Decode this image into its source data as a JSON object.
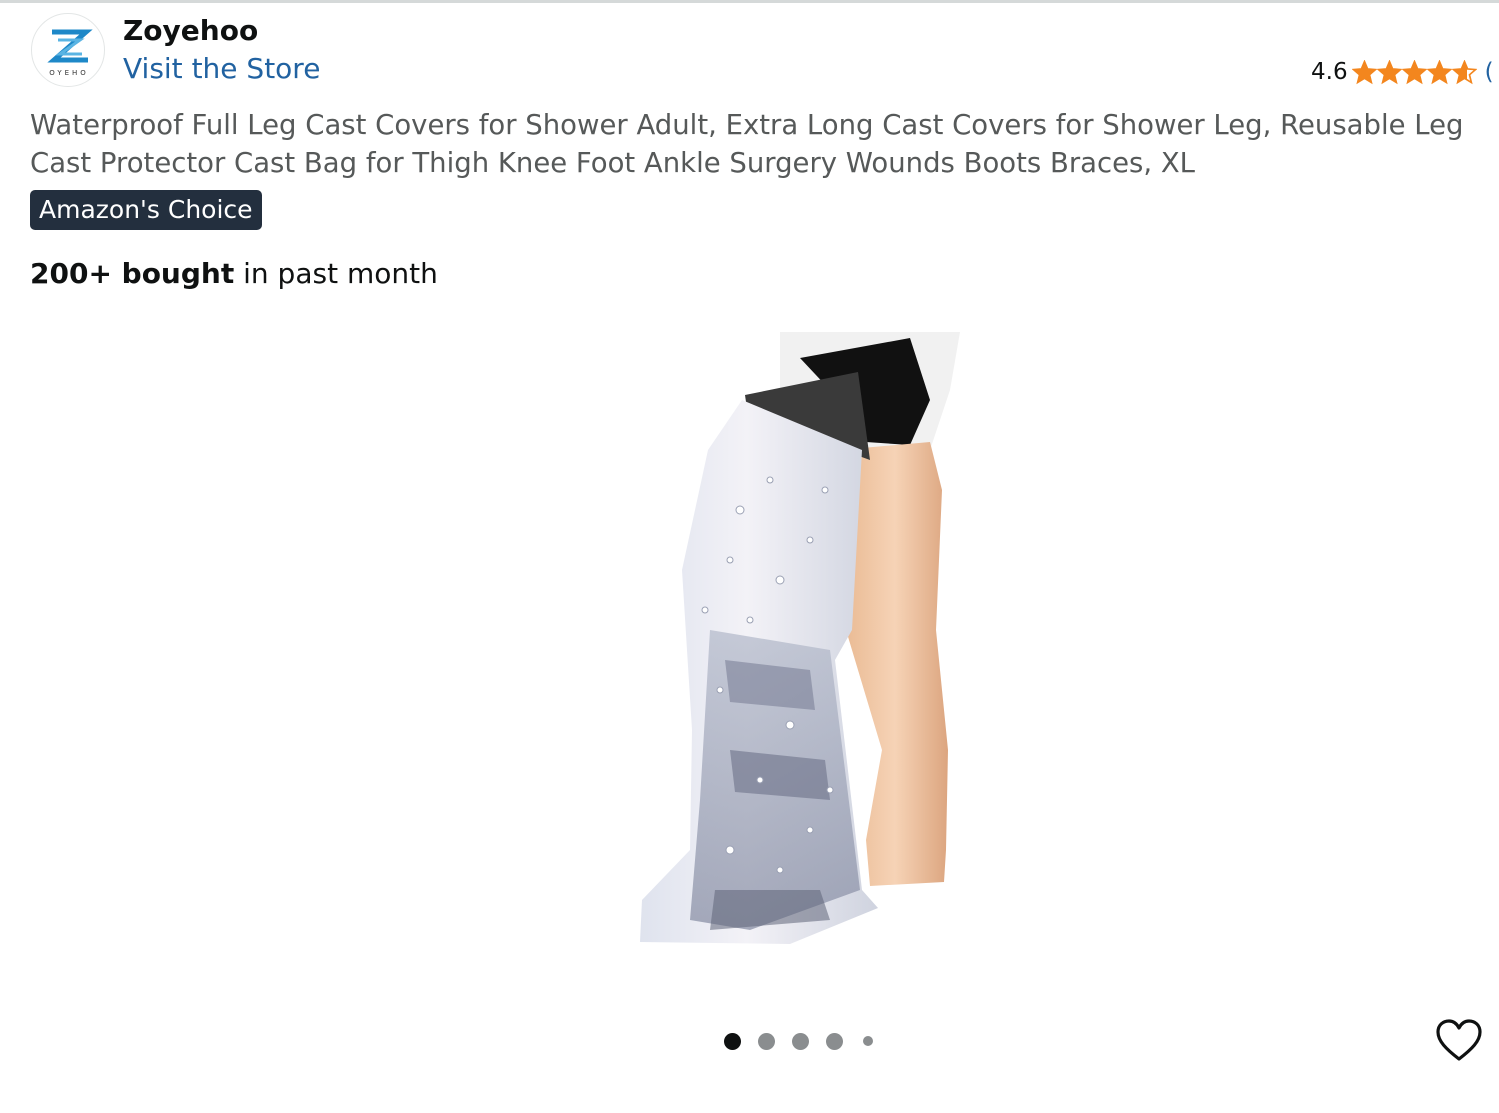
{
  "header": {
    "brand_name": "Zoyehoo",
    "visit_store_label": "Visit the Store",
    "logo_text": "OYEHO"
  },
  "rating": {
    "value": "4.6",
    "stars": 4.6,
    "count_prefix": "(",
    "star_color": "#f3861e"
  },
  "product": {
    "title": "Waterproof Full Leg Cast Covers for Shower Adult, Extra Long Cast Covers for Shower Leg, Reusable Leg Cast Protector Cast Bag for Thigh Knee Foot Ankle Surgery Wounds Boots Braces, XL",
    "badge": "Amazon's Choice",
    "bought_bold": "200+ bought",
    "bought_rest": " in past month"
  },
  "carousel": {
    "total_images": 5,
    "active_index": 0
  },
  "icons": {
    "logo": "zoyehoo-logo-icon",
    "star": "star-icon",
    "wishlist": "heart-icon"
  },
  "colors": {
    "link": "#2162a1",
    "badge_bg": "#232f3e",
    "title_text": "#565959"
  }
}
